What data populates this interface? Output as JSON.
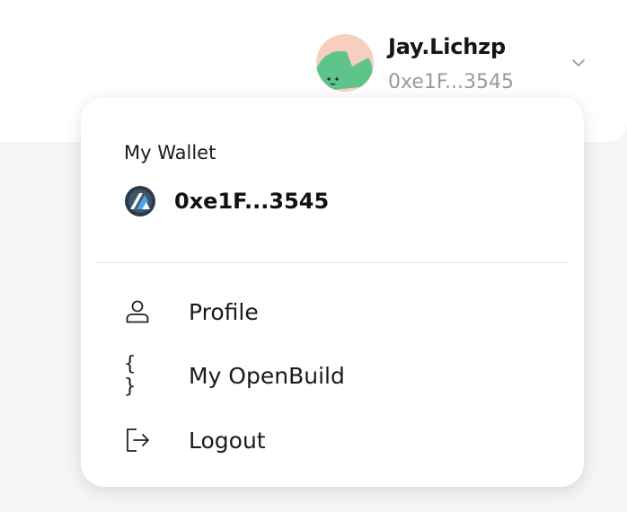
{
  "user": {
    "name": "Jay.Lichzp",
    "address": "0xe1F...3545"
  },
  "wallet": {
    "title": "My Wallet",
    "address": "0xe1F...3545"
  },
  "menu": {
    "items": [
      {
        "label": "Profile",
        "icon": "user-icon"
      },
      {
        "label": "My OpenBuild",
        "icon": "braces-icon",
        "glyph": "{ }"
      },
      {
        "label": "Logout",
        "icon": "logout-icon"
      }
    ]
  },
  "colors": {
    "avatar_bg": "#f6cfc0",
    "avatar_fg": "#5ec48a",
    "muted_text": "#9a9a9a"
  }
}
